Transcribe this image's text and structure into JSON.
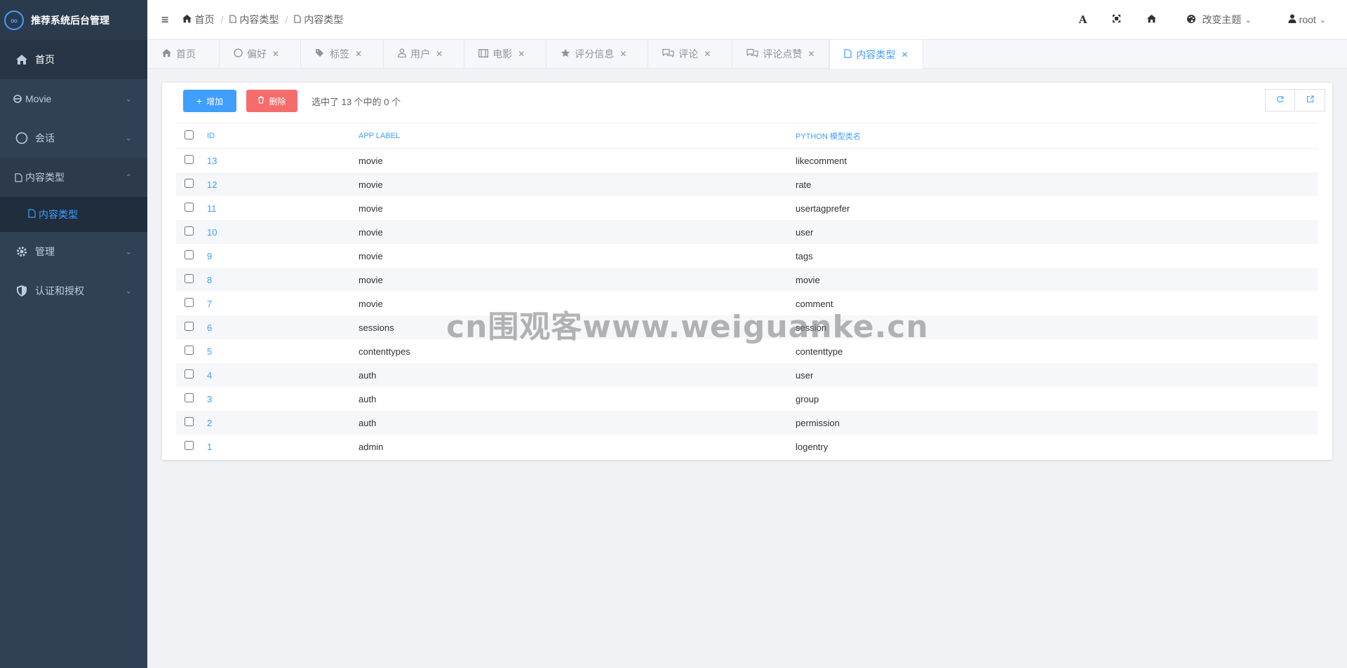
{
  "app": {
    "title": "推荐系统后台管理",
    "logo_glyph": "∞"
  },
  "sidebar": {
    "items": [
      {
        "label": "首页",
        "icon": "home-icon"
      },
      {
        "label": "Movie",
        "icon": "ie-icon"
      },
      {
        "label": "会话",
        "icon": "circle-icon"
      },
      {
        "label": "内容类型",
        "icon": "file-icon"
      },
      {
        "label": "管理",
        "icon": "gear-icon"
      },
      {
        "label": "认证和授权",
        "icon": "shield-icon"
      }
    ],
    "submenu": {
      "label": "内容类型",
      "icon": "file-icon"
    }
  },
  "header": {
    "breadcrumb": [
      "首页",
      "内容类型",
      "内容类型"
    ],
    "theme_label": "改变主题",
    "user_label": "root"
  },
  "tabs": [
    {
      "label": "首页",
      "icon": "home-icon"
    },
    {
      "label": "偏好",
      "icon": "circle-icon"
    },
    {
      "label": "标签",
      "icon": "tags-icon"
    },
    {
      "label": "用户",
      "icon": "user-icon"
    },
    {
      "label": "电影",
      "icon": "film-icon"
    },
    {
      "label": "评分信息",
      "icon": "star-icon"
    },
    {
      "label": "评论",
      "icon": "comments-icon"
    },
    {
      "label": "评论点赞",
      "icon": "comments-icon"
    },
    {
      "label": "内容类型",
      "icon": "file-icon",
      "active": true
    }
  ],
  "toolbar": {
    "add_label": "增加",
    "delete_label": "删除",
    "selection_info": "选中了 13 个中的 0 个"
  },
  "table": {
    "columns": [
      "ID",
      "APP LABEL",
      "PYTHON 模型类名"
    ],
    "rows": [
      {
        "id": "13",
        "app_label": "movie",
        "model": "likecomment"
      },
      {
        "id": "12",
        "app_label": "movie",
        "model": "rate"
      },
      {
        "id": "11",
        "app_label": "movie",
        "model": "usertagprefer"
      },
      {
        "id": "10",
        "app_label": "movie",
        "model": "user"
      },
      {
        "id": "9",
        "app_label": "movie",
        "model": "tags"
      },
      {
        "id": "8",
        "app_label": "movie",
        "model": "movie"
      },
      {
        "id": "7",
        "app_label": "movie",
        "model": "comment"
      },
      {
        "id": "6",
        "app_label": "sessions",
        "model": "session"
      },
      {
        "id": "5",
        "app_label": "contenttypes",
        "model": "contenttype"
      },
      {
        "id": "4",
        "app_label": "auth",
        "model": "user"
      },
      {
        "id": "3",
        "app_label": "auth",
        "model": "group"
      },
      {
        "id": "2",
        "app_label": "auth",
        "model": "permission"
      },
      {
        "id": "1",
        "app_label": "admin",
        "model": "logentry"
      }
    ]
  },
  "watermark": "cn围观客www.weiguanke.cn",
  "colors": {
    "accent": "#409eff",
    "danger": "#f56c6c",
    "sidebar_bg": "#304156"
  }
}
